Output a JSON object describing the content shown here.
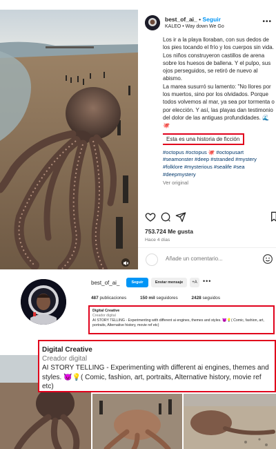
{
  "post": {
    "username": "best_of_ai_",
    "separator": "•",
    "follow_label": "Seguir",
    "music": "KALEO • Way down We Go",
    "caption": "Los ir a la playa lloraban, con sus dedos de los pies tocando el frío y los cuerpos sin vida. Los niños construyeron castillos de arena sobre los huesos de ballena. Y el pulpo, sus ojos perseguidos, se retiró de nuevo al abismo.\nLa marea susurró su lamento: \"No llores por los muertos, sino por los olvidados. Porque todos volvemos al mar, ya sea por tormenta o por elección. Y así, las playas dan testimonio del dolor de las antiguas profundidades. 🌊 🐙",
    "fiction_note": "Esta es una historia de ficción",
    "hashtags": "#octopus #octopus 🐙 #octopusart #seamonster #deep #stranded #mystery #folklore #mysterious #sealife #sea #deepmystery",
    "see_translation": "Ver original",
    "likes": "753.724 Me gusta",
    "time_ago": "Hace 4 días",
    "comment_placeholder": "Añade un comentario..."
  },
  "profile": {
    "username": "best_of_ai_",
    "follow_label": "Seguir",
    "message_label": "Enviar mensaje",
    "suggest_label": "+A",
    "more_label": "•••",
    "stats": {
      "posts_value": "487",
      "posts_label": "publicaciones",
      "followers_value": "150 mil",
      "followers_label": "seguidores",
      "following_value": "2428",
      "following_label": "seguidos"
    },
    "bio_name": "Digital Creative",
    "bio_category": "Creador digital",
    "bio_text": "AI STORY TELLING - Experimenting with different ai engines, themes and styles. 😈💡( Comic, fashion, art, portraits, Alternative history, movie ref etc)"
  },
  "icons": [
    "heart-icon",
    "comment-icon",
    "share-icon",
    "bookmark-icon",
    "emoji-icon",
    "more-icon",
    "mute-icon"
  ],
  "colors": {
    "accent": "#0095f6",
    "highlight": "#e0001b",
    "link": "#00376b"
  }
}
